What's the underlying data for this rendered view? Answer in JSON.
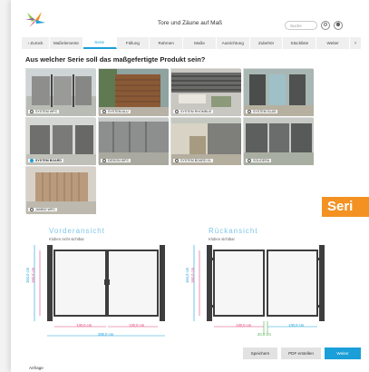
{
  "header": {
    "title": "Tore und Zäune auf Maß",
    "search_placeholder": "Suche"
  },
  "tabs": [
    "Maßelemente",
    "Serie",
    "Füllung",
    "Rahmen",
    "Maße",
    "Ausrichtung",
    "Zubehör",
    "Stückliste",
    "Weiter"
  ],
  "nav": {
    "back_label": "Zurück",
    "back_arrow": "‹",
    "next_arrow": "›"
  },
  "active_tab": "Serie",
  "question": "Aus welcher Serie soll das maßgefertigte Produkt sein?",
  "series": [
    {
      "label": "SYSTEM WPC",
      "selected": false
    },
    {
      "label": "SYSTEM ALU",
      "selected": false
    },
    {
      "label": "SYSTEM RHOMBUS",
      "selected": false
    },
    {
      "label": "SYSTEM GLAS",
      "selected": false
    },
    {
      "label": "SYSTEM BOARD",
      "selected": true
    },
    {
      "label": "DESIGN WPC",
      "selected": false
    },
    {
      "label": "SYSTEM BOARD XL",
      "selected": false
    },
    {
      "label": "SOLIDERA",
      "selected": false
    },
    {
      "label": "JUMBO WPC",
      "selected": false
    }
  ],
  "side_tab": "Seri",
  "front_view": {
    "title": "Vorderansicht",
    "subtitle": "Kloben nicht sichtbar",
    "dim_height_outer": "164,0 cm",
    "dim_height_inner": "160,0 cm",
    "dim_left": "130,0 cm",
    "dim_right": "130,0 cm",
    "dim_total": "280,0 cm"
  },
  "back_view": {
    "title": "Rückansicht",
    "subtitle": "Kloben sichtbar",
    "dim_height_outer": "164,0 cm",
    "dim_height_inner": "160,0 cm",
    "dim_left": "130,0 cm",
    "dim_right": "130,0 cm",
    "dim_gap": "20,0 cm"
  },
  "buttons": {
    "save": "Speichern",
    "pdf": "PDF erstellen",
    "next": "Weiter"
  },
  "footer": "Anfrage",
  "colors": {
    "accent": "#1a9fd8",
    "orange": "#f39222",
    "frame": "#3d3d3d",
    "dim_blue": "#1a9fd8",
    "dim_pink": "#e0457b",
    "dim_green": "#4caf50"
  }
}
